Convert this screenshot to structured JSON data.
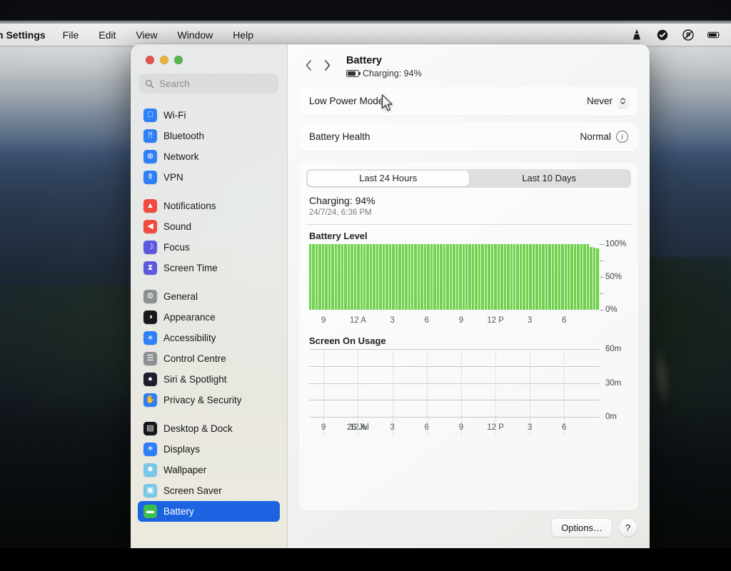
{
  "menubar": {
    "app_title": "n Settings",
    "items": [
      "File",
      "Edit",
      "View",
      "Window",
      "Help"
    ],
    "status_icons": [
      "vlc-cone-icon",
      "checkmark-circle-icon",
      "headphones-icon",
      "battery-icon"
    ]
  },
  "window": {
    "traffic_lights": [
      "close",
      "minimize",
      "zoom"
    ]
  },
  "search": {
    "placeholder": "Search",
    "value": ""
  },
  "sidebar": {
    "groups": [
      {
        "items": [
          {
            "label": "Wi-Fi",
            "icon": "wifi-icon",
            "color": "#2c7ef8",
            "glyph": ""
          },
          {
            "label": "Bluetooth",
            "icon": "bluetooth-icon",
            "color": "#2c7ef8",
            "glyph": "ᛗ"
          },
          {
            "label": "Network",
            "icon": "network-globe-icon",
            "color": "#2c7ef8",
            "glyph": "⊕"
          },
          {
            "label": "VPN",
            "icon": "vpn-icon",
            "color": "#2c7ef8",
            "glyph": "⚱"
          }
        ]
      },
      {
        "items": [
          {
            "label": "Notifications",
            "icon": "notifications-bell-icon",
            "color": "#f1473c",
            "glyph": "▲"
          },
          {
            "label": "Sound",
            "icon": "sound-speaker-icon",
            "color": "#f1473c",
            "glyph": "◀"
          },
          {
            "label": "Focus",
            "icon": "focus-moon-icon",
            "color": "#5a55e0",
            "glyph": "☽"
          },
          {
            "label": "Screen Time",
            "icon": "screen-time-hourglass-icon",
            "color": "#5a55e0",
            "glyph": "⧗"
          }
        ]
      },
      {
        "items": [
          {
            "label": "General",
            "icon": "general-gear-icon",
            "color": "#8b8f92",
            "glyph": "⚙"
          },
          {
            "label": "Appearance",
            "icon": "appearance-icon",
            "color": "#14161a",
            "glyph": "◑"
          },
          {
            "label": "Accessibility",
            "icon": "accessibility-icon",
            "color": "#2c7ef8",
            "glyph": "⚹"
          },
          {
            "label": "Control Centre",
            "icon": "control-centre-icon",
            "color": "#8b8f92",
            "glyph": "☰"
          },
          {
            "label": "Siri & Spotlight",
            "icon": "siri-spotlight-icon",
            "color": "#1e1b2e",
            "glyph": "●"
          },
          {
            "label": "Privacy & Security",
            "icon": "privacy-security-hand-icon",
            "color": "#2c7ef8",
            "glyph": "✋"
          }
        ]
      },
      {
        "items": [
          {
            "label": "Desktop & Dock",
            "icon": "desktop-dock-icon",
            "color": "#14161a",
            "glyph": "▤"
          },
          {
            "label": "Displays",
            "icon": "displays-icon",
            "color": "#2c7ef8",
            "glyph": "☀"
          },
          {
            "label": "Wallpaper",
            "icon": "wallpaper-icon",
            "color": "#79c7e8",
            "glyph": "✸"
          },
          {
            "label": "Screen Saver",
            "icon": "screen-saver-icon",
            "color": "#79c7e8",
            "glyph": "▣"
          },
          {
            "label": "Battery",
            "icon": "battery-icon",
            "color": "#3bbf4c",
            "glyph": "▬",
            "selected": true
          }
        ]
      }
    ]
  },
  "detail": {
    "back_icon": "chevron-left-icon",
    "forward_icon": "chevron-right-icon",
    "title": "Battery",
    "subtitle": "Charging: 94%",
    "subtitle_icon": "battery-charging-icon",
    "low_power_mode": {
      "label": "Low Power Mode",
      "value": "Never",
      "control_icon": "up-down-chevrons-icon"
    },
    "battery_health": {
      "label": "Battery Health",
      "value": "Normal",
      "info_icon": "info-circle-icon"
    },
    "segments": [
      {
        "label": "Last 24 Hours",
        "active": true
      },
      {
        "label": "Last 10 Days",
        "active": false
      }
    ],
    "charging_status": "Charging: 94%",
    "charging_timestamp": "24/7/24, 6:36 PM",
    "footer": {
      "options_label": "Options…",
      "help_label": "?"
    }
  },
  "chart_data": [
    {
      "type": "bar",
      "title": "Battery Level",
      "xlabel": "",
      "ylabel": "",
      "ylim": [
        0,
        100
      ],
      "ytick_labels": [
        "100%",
        "50%",
        "0%"
      ],
      "ytick_values": [
        100,
        50,
        0
      ],
      "yminor_values": [
        75,
        25
      ],
      "xtick_labels": [
        "9",
        "12 A",
        "3",
        "6",
        "9",
        "12 P",
        "3",
        "6"
      ],
      "grid": false,
      "bar_color": "#6ed04a",
      "categories": [
        "20:00",
        "20:15",
        "20:30",
        "20:45",
        "21:00",
        "21:15",
        "21:30",
        "21:45",
        "22:00",
        "22:15",
        "22:30",
        "22:45",
        "23:00",
        "23:15",
        "23:30",
        "23:45",
        "00:00",
        "00:15",
        "00:30",
        "00:45",
        "01:00",
        "01:15",
        "01:30",
        "01:45",
        "02:00",
        "02:15",
        "02:30",
        "02:45",
        "03:00",
        "03:15",
        "03:30",
        "03:45",
        "04:00",
        "04:15",
        "04:30",
        "04:45",
        "05:00",
        "05:15",
        "05:30",
        "05:45",
        "06:00",
        "06:15",
        "06:30",
        "06:45",
        "07:00",
        "07:15",
        "07:30",
        "07:45",
        "08:00",
        "08:15",
        "08:30",
        "08:45",
        "09:00",
        "09:15",
        "09:30",
        "09:45",
        "10:00",
        "10:15",
        "10:30",
        "10:45",
        "11:00",
        "11:15",
        "11:30",
        "11:45",
        "12:00",
        "12:15",
        "12:30",
        "12:45",
        "13:00",
        "13:15",
        "13:30",
        "13:45",
        "14:00",
        "14:15",
        "14:30",
        "14:45",
        "15:00",
        "15:15",
        "15:30",
        "15:45",
        "16:00",
        "16:15",
        "16:30",
        "16:45",
        "17:00",
        "17:15",
        "17:30",
        "17:45",
        "18:00",
        "18:15",
        "18:30"
      ],
      "values": [
        100,
        100,
        100,
        100,
        100,
        100,
        100,
        100,
        100,
        100,
        100,
        100,
        100,
        100,
        100,
        100,
        100,
        100,
        100,
        100,
        100,
        100,
        100,
        100,
        100,
        100,
        100,
        100,
        100,
        100,
        100,
        100,
        100,
        100,
        100,
        100,
        100,
        100,
        100,
        100,
        100,
        100,
        100,
        100,
        100,
        100,
        100,
        100,
        100,
        100,
        100,
        100,
        100,
        100,
        100,
        100,
        100,
        100,
        100,
        100,
        100,
        100,
        100,
        100,
        100,
        100,
        100,
        100,
        100,
        100,
        100,
        100,
        100,
        100,
        100,
        100,
        100,
        100,
        100,
        100,
        100,
        100,
        100,
        100,
        100,
        100,
        100,
        100,
        96,
        95,
        94
      ]
    },
    {
      "type": "line",
      "title": "Screen On Usage",
      "xlabel": "",
      "ylabel": "",
      "ylim": [
        0,
        60
      ],
      "ytick_labels": [
        "60m",
        "30m",
        "0m"
      ],
      "ytick_values": [
        60,
        30,
        0
      ],
      "yminor_values": [
        45,
        15
      ],
      "xtick_labels": [
        "9",
        "12 A",
        "3",
        "6",
        "9",
        "12 P",
        "3",
        "6"
      ],
      "x_subdate": "26 Jul",
      "grid": true,
      "values": []
    }
  ]
}
